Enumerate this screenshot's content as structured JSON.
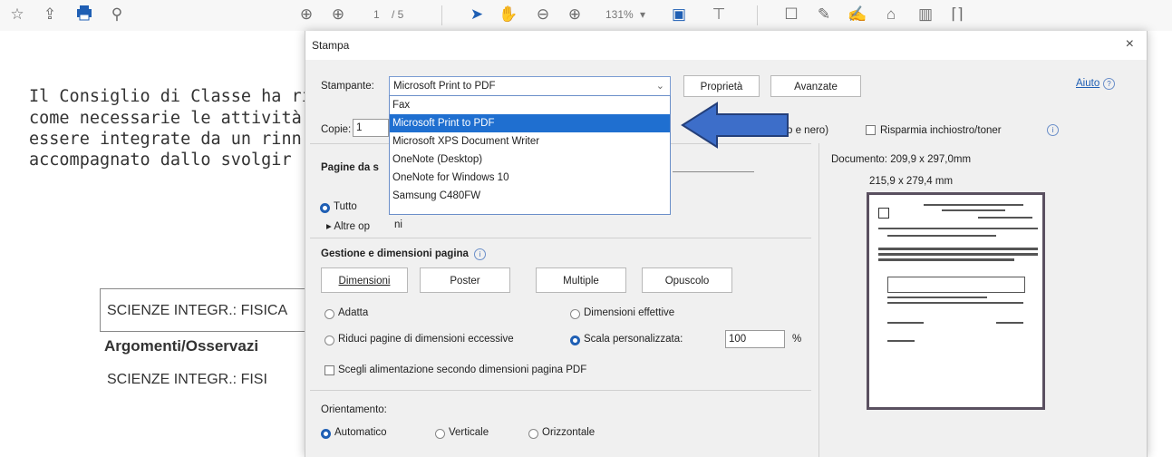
{
  "toolbar": {
    "page_current": "1",
    "page_total": "/ 5",
    "zoom": "131%",
    "icons": [
      "star-icon",
      "share-icon",
      "print-icon",
      "search-icon",
      "prev-page-icon",
      "next-page-icon",
      "select-arrow-icon",
      "hand-icon",
      "zoom-out-icon",
      "zoom-in-icon",
      "page-fit-icon",
      "scroll-icon",
      "comment-icon",
      "pen-icon",
      "sign-icon",
      "stamp-icon",
      "trash-icon",
      "more-icon"
    ]
  },
  "document": {
    "lines": [
      "Il Consiglio di Classe ha ril",
      "come necessarie le attività",
      "essere integrate da un rinn",
      "accompagnato dallo svolgir"
    ],
    "cell1": "SCIENZE INTEGR.: FISICA",
    "heading": "Argomenti/Osservazi",
    "cell2": "SCIENZE INTEGR.: FISI"
  },
  "dialog": {
    "title": "Stampa",
    "close": "×",
    "printer_label": "Stampante:",
    "printer_selected": "Microsoft Print to PDF",
    "printer_options": [
      "Fax",
      "Microsoft Print to PDF",
      "Microsoft XPS Document Writer",
      "OneNote (Desktop)",
      "OneNote for Windows 10",
      "Samsung C480FW"
    ],
    "properties_button": "Proprietà",
    "advanced_button": "Avanzate",
    "help_link": "Aiuto",
    "copies_label": "Copie:",
    "copies_value": "1",
    "bw_partial": "o e nero)",
    "save_ink_label": "Risparmia inchiostro/toner",
    "pages_label": "Pagine da s",
    "all_label": "Tutto",
    "more_options": "▸ Altre op",
    "more_options_tail": "ni",
    "page_mgmt_label": "Gestione e dimensioni pagina",
    "tab_dimensions": "Dimensioni",
    "tab_poster": "Poster",
    "tab_multiple": "Multiple",
    "tab_booklet": "Opuscolo",
    "fit_label": "Adatta",
    "actual_size_label": "Dimensioni effettive",
    "shrink_label": "Riduci pagine di dimensioni eccessive",
    "custom_scale_label": "Scala personalizzata:",
    "scale_value": "100",
    "percent": "%",
    "paper_source_label": "Scegli alimentazione secondo dimensioni pagina PDF",
    "orientation_label": "Orientamento:",
    "orient_auto": "Automatico",
    "orient_portrait": "Verticale",
    "orient_landscape": "Orizzontale",
    "document_size": "Documento: 209,9 x 297,0mm",
    "paper_size": "215,9 x 279,4 mm"
  },
  "colors": {
    "accent": "#1f6fd0",
    "arrow": "#3d6ec9",
    "arrow_border": "#243f7a"
  }
}
